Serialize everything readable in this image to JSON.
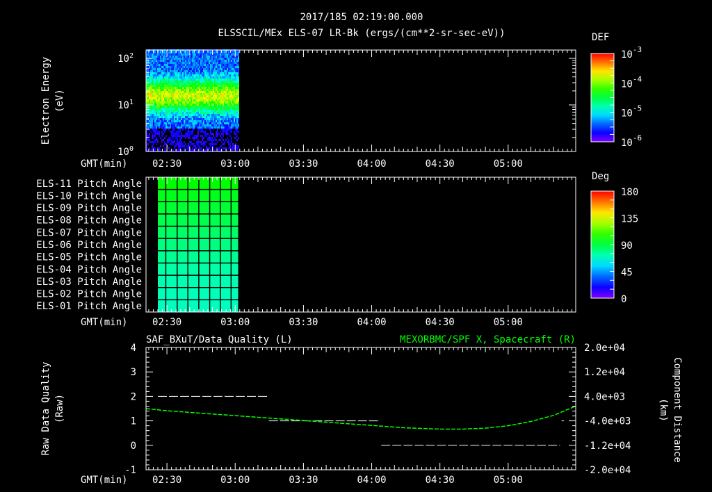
{
  "title": "2017/185 02:19:00.000",
  "subtitle": "ELSSCIL/MEx ELS-07 LR-Bk  (ergs/(cm**2-sr-sec-eV))",
  "time_axis": {
    "label": "GMT(min)",
    "ticks": [
      "02:30",
      "03:00",
      "03:30",
      "04:00",
      "04:30",
      "05:00"
    ],
    "tick_minutes": [
      150,
      180,
      210,
      240,
      270,
      300
    ],
    "range_minutes": [
      140.8,
      329.7
    ]
  },
  "colors": {
    "background": "#000000",
    "axes": "#ffffff",
    "series_right": "#00ff00"
  },
  "chart_data": [
    {
      "type": "heatmap",
      "name": "electron-energy-spectrogram",
      "ylabel": [
        "Electron Energy",
        "(eV)"
      ],
      "yscale": "log",
      "ylim": [
        1,
        141
      ],
      "ytick_labels": [
        {
          "base": "10",
          "exp": "0",
          "value": 1
        },
        {
          "base": "10",
          "exp": "1",
          "value": 10
        },
        {
          "base": "10",
          "exp": "2",
          "value": 100
        }
      ],
      "data_time_range_minutes": [
        140.8,
        181.3
      ],
      "peak_energy_eV": 15,
      "colorbar": {
        "title": "DEF",
        "scale": "log",
        "range": [
          1e-06,
          0.001
        ],
        "tick_labels": [
          {
            "base": "10",
            "exp": "-3"
          },
          {
            "base": "10",
            "exp": "-4"
          },
          {
            "base": "10",
            "exp": "-5"
          },
          {
            "base": "10",
            "exp": "-6"
          }
        ]
      }
    },
    {
      "type": "heatmap",
      "name": "pitch-angle",
      "rows": [
        "ELS-11 Pitch Angle",
        "ELS-10 Pitch Angle",
        "ELS-09 Pitch Angle",
        "ELS-08 Pitch Angle",
        "ELS-07 Pitch Angle",
        "ELS-06 Pitch Angle",
        "ELS-05 Pitch Angle",
        "ELS-04 Pitch Angle",
        "ELS-03 Pitch Angle",
        "ELS-02 Pitch Angle",
        "ELS-01 Pitch Angle"
      ],
      "row_values_deg": [
        100,
        96,
        92,
        88,
        84,
        80,
        77,
        74,
        72,
        71,
        70
      ],
      "data_time_range_minutes": [
        146.0,
        181.3
      ],
      "column_boundaries_minutes": [
        149.5,
        154.5,
        159.2,
        164.0,
        168.8,
        173.5,
        178.2
      ],
      "colorbar": {
        "title": "Deg",
        "range": [
          0,
          180
        ],
        "tick_labels": [
          "180",
          "135",
          "90",
          "45",
          "0"
        ],
        "tick_values": [
          180,
          135,
          90,
          45,
          0
        ]
      }
    },
    {
      "type": "line",
      "name": "data-quality-and-position",
      "left": {
        "title": "SAF_BXuT/Data Quality (L)",
        "ylabel": [
          "Raw Data Quality",
          "(Raw)"
        ],
        "ylim": [
          -1,
          4
        ],
        "tick_labels": [
          "4",
          "3",
          "2",
          "1",
          "0",
          "-1"
        ],
        "segments": [
          {
            "x": [
              146.0,
              194.5
            ],
            "y": 2
          },
          {
            "x": [
              194.8,
              243.8
            ],
            "y": 1
          },
          {
            "x": [
              244.2,
              322.8
            ],
            "y": 0
          },
          {
            "x": [
              323.5,
              324.5
            ],
            "y": 1
          }
        ]
      },
      "right": {
        "title": "MEXORBMC/SPF X, Spacecraft (R)",
        "ylabel": [
          "Component Distance",
          "(km)"
        ],
        "ylim": [
          -20000,
          20000
        ],
        "tick_labels": [
          "2.0e+04",
          "1.2e+04",
          "4.0e+03",
          "-4.0e+03",
          "-1.2e+04",
          "-2.0e+04"
        ],
        "x": [
          140.8,
          150,
          165,
          180,
          195,
          210,
          225,
          240,
          255,
          270,
          280,
          290,
          300,
          310,
          320,
          329.7
        ],
        "y": [
          0,
          -700,
          -1500,
          -2300,
          -3100,
          -3900,
          -4700,
          -5500,
          -6300,
          -6700,
          -6700,
          -6400,
          -5600,
          -4200,
          -2200,
          800
        ]
      }
    }
  ]
}
